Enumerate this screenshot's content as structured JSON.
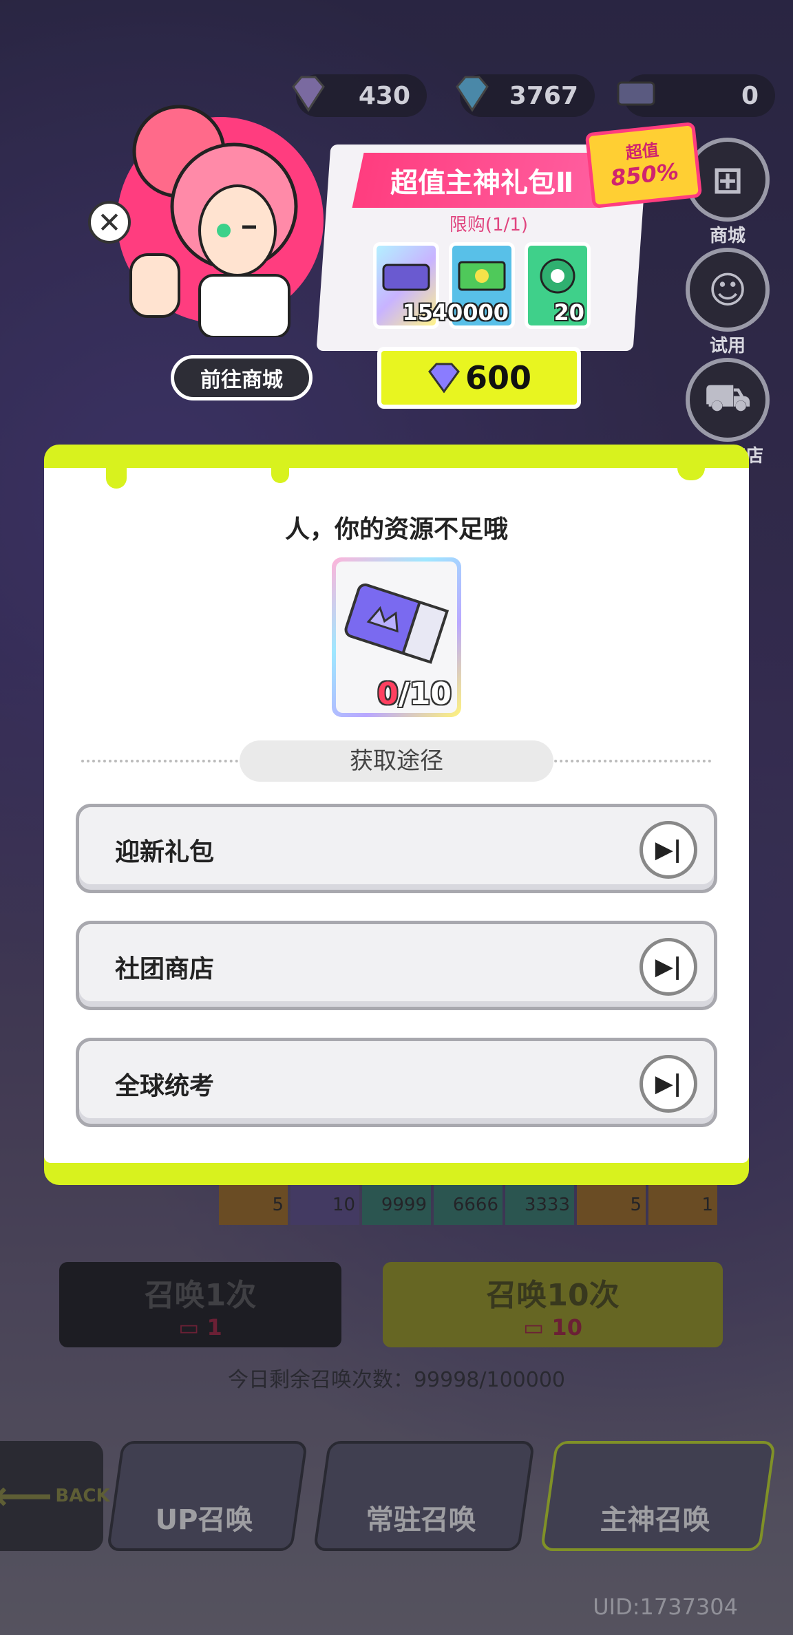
{
  "currencies": [
    {
      "name": "purple-gem",
      "value": "430"
    },
    {
      "name": "blue-gem",
      "value": "3767"
    },
    {
      "name": "ticket",
      "value": "0"
    }
  ],
  "side_menu": {
    "shop": "商城",
    "trial": "试用",
    "exchange": "兑换商店"
  },
  "promo": {
    "title": "超值主神礼包Ⅱ",
    "tag_line1": "超值",
    "tag_line2": "850%",
    "limit": "限购(1/1)",
    "items": [
      {
        "icon": "ticket-icon",
        "count": "15"
      },
      {
        "icon": "cash-icon",
        "count": "40000"
      },
      {
        "icon": "coin-icon",
        "count": "20"
      }
    ],
    "price": "600",
    "goto_shop": "前往商城"
  },
  "modal": {
    "title": "人，你的资源不足哦",
    "ticket_have": "0",
    "ticket_need": "/10",
    "section_label": "获取途径",
    "routes": [
      {
        "label": "迎新礼包"
      },
      {
        "label": "社团商店"
      },
      {
        "label": "全球统考"
      }
    ]
  },
  "summon": {
    "once_label": "召唤1次",
    "once_cost": "1",
    "ten_label": "召唤10次",
    "ten_cost": "10",
    "daily_remaining": "今日剩余召唤次数：99998/100000"
  },
  "reward_strip": [
    "5",
    "10",
    "9999",
    "6666",
    "3333",
    "5",
    "1"
  ],
  "tabs": {
    "back": "BACK",
    "up": "UP召唤",
    "standard": "常驻召唤",
    "god": "主神召唤"
  },
  "uid": "UID:1737304",
  "colors": {
    "accent": "#d8f21e",
    "pink": "#ff3d7f",
    "dark": "#2d2d36"
  }
}
